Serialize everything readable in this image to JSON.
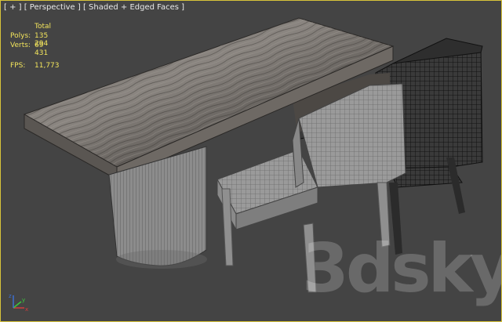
{
  "viewport": {
    "label": "[ + ] [ Perspective ] [ Shaded + Edged Faces ]",
    "accent_border": "#d8c33a",
    "background": "#444444"
  },
  "stats": {
    "header": "Total",
    "polys_label": "Polys:",
    "polys_value": "135 294",
    "verts_label": "Verts:",
    "verts_value": "69 431",
    "fps_label": "FPS:",
    "fps_value": "11,773",
    "color": "#f2e45c"
  },
  "watermark": {
    "text": "3dsky"
  },
  "gizmo": {
    "axes": [
      "x",
      "y",
      "z"
    ],
    "colors": {
      "x": "#d23c3c",
      "y": "#3cc83c",
      "z": "#3c6ed2"
    }
  }
}
